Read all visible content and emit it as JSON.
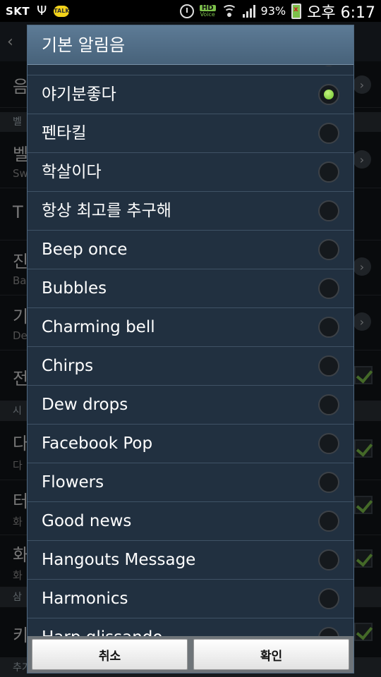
{
  "status_bar": {
    "carrier": "SKT",
    "hd_label": "HD",
    "hd_sub": "Voice",
    "battery": "93%",
    "time": "오후 6:17"
  },
  "background": {
    "rows": [
      {
        "title": "음",
        "subtitle": ""
      },
      {
        "title": "벨",
        "subtitle": "Sw"
      },
      {
        "title": "T",
        "subtitle": ""
      },
      {
        "title": "진",
        "subtitle": "Ba"
      },
      {
        "title": "기",
        "subtitle": "De"
      },
      {
        "title": "전",
        "subtitle": ""
      },
      {
        "title": "다",
        "subtitle": "다"
      },
      {
        "title": "터",
        "subtitle": "화"
      },
      {
        "title": "화",
        "subtitle": "화"
      },
      {
        "title": "키",
        "subtitle": ""
      }
    ],
    "sections": [
      "벨",
      "시",
      "삼",
      "추가 설정"
    ]
  },
  "dialog": {
    "title": "기본 알림음",
    "selected_index": 0,
    "items": [
      {
        "label": "야기분좋다"
      },
      {
        "label": "펜타킬"
      },
      {
        "label": "학살이다"
      },
      {
        "label": "항상 최고를 추구해"
      },
      {
        "label": "Beep once"
      },
      {
        "label": "Bubbles"
      },
      {
        "label": "Charming bell"
      },
      {
        "label": "Chirps"
      },
      {
        "label": "Dew drops"
      },
      {
        "label": "Facebook Pop"
      },
      {
        "label": "Flowers"
      },
      {
        "label": "Good news"
      },
      {
        "label": "Hangouts Message"
      },
      {
        "label": "Harmonics"
      },
      {
        "label": "Harp glissando"
      }
    ],
    "cancel_label": "취소",
    "confirm_label": "확인"
  },
  "colors": {
    "dialog_bg": "#22303e",
    "title_bar": "#5d7b96",
    "selected_radio": "#7cc04a"
  }
}
